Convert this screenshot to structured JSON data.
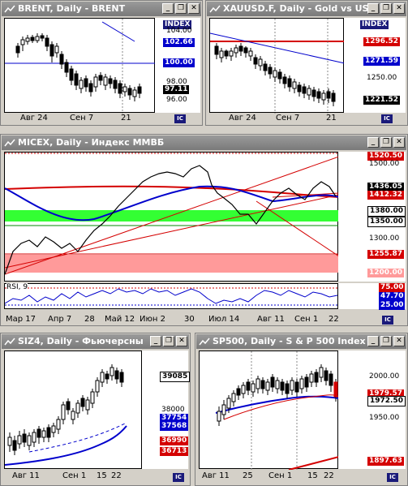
{
  "windows": {
    "brent": {
      "title": "BRENT, Daily - BRENT",
      "index_label": "INDEX",
      "scale": [
        "104.00",
        "98.00",
        "96.00"
      ],
      "tags": {
        "blue": "102.66",
        "hline": "100.00",
        "price": "97.11"
      },
      "xaxis": [
        "Авг 24",
        "Сен 7",
        "21"
      ]
    },
    "gold": {
      "title": "XAUUSD.F, Daily - Gold vs US",
      "index_label": "INDEX",
      "scale": [
        "1250.00"
      ],
      "tags": {
        "red": "1296.52",
        "blue": "1271.59",
        "price": "1221.52"
      },
      "xaxis": [
        "Авг 24",
        "Сен 7",
        "21"
      ]
    },
    "micex": {
      "title": "MICEX, Daily - Индекс ММВБ",
      "scale": [
        "1500.00",
        "1300.00"
      ],
      "tags": {
        "red_top": "1520.50",
        "price": "1436.05",
        "red2": "1412.32",
        "green1": "1380.00",
        "green2": "1350.00",
        "red3": "1255.87",
        "pink": "1200.00"
      },
      "rsi_label": "RSI, 9",
      "rsi_tags": {
        "r75": "75.00",
        "r47": "47.70",
        "r25": "25.00"
      },
      "xaxis": [
        "Мар 17",
        "Апр 7",
        "28",
        "Май 12",
        "Июн 2",
        "30",
        "Июл 14",
        "Авг 11",
        "Сен 1",
        "22"
      ]
    },
    "siz4": {
      "title": "SIZ4, Daily - Фьючерсны",
      "scale": [
        "38000"
      ],
      "tags": {
        "price": "39085",
        "blue1": "37754",
        "blue2": "37568",
        "red1": "36990",
        "red2": "36713"
      },
      "xaxis": [
        "Авг 11",
        "Сен 1",
        "15",
        "22"
      ]
    },
    "sp500": {
      "title": "SP500, Daily - S & P 500 Index",
      "scale": [
        "2000.00",
        "1950.00"
      ],
      "tags": {
        "red": "1979.57",
        "price": "1972.50",
        "red_low": "1897.63"
      },
      "xaxis": [
        "Авг 11",
        "25",
        "Сен 1",
        "15",
        "22"
      ]
    }
  },
  "icons": {
    "minimize": "minimize-icon",
    "restore": "restore-icon",
    "close": "close-icon",
    "badge": "chart-settings-icon"
  },
  "button_glyphs": {
    "minimize": "_",
    "restore": "❐",
    "close": "✕",
    "badge": "IC"
  },
  "colors": {
    "title_bar": "#8a8a8a",
    "support_green": "#33ff33",
    "resistance_pink": "#ff9a9a",
    "ma_red": "#d40000",
    "ma_blue": "#0000cc",
    "price_tag_black": "#000000"
  }
}
